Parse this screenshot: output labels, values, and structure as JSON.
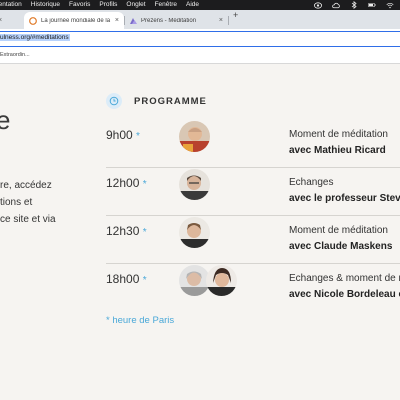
{
  "menubar": {
    "items": [
      "présentation",
      "Historique",
      "Favoris",
      "Profils",
      "Onglet",
      "Fenêtre",
      "Aide"
    ]
  },
  "tabs": [
    {
      "label": "La journée mondiale de la Méditation",
      "close": "×"
    },
    {
      "label": "Prezens - Méditation",
      "close": "×"
    }
  ],
  "new_tab": "+",
  "address_bar": {
    "url": "ulness.org/#meditations"
  },
  "bookmarks": {
    "item": "Extraordin..."
  },
  "left_text": {
    "heading": "e",
    "lines": [
      "re, accédez",
      "tions et",
      "ce site et via"
    ]
  },
  "programme": {
    "title": "PROGRAMME",
    "rows": [
      {
        "time": "9h00",
        "star": "*",
        "line1": "Moment de méditation",
        "line2": "avec Mathieu Ricard"
      },
      {
        "time": "12h00",
        "star": "*",
        "line1": "Echanges",
        "line2": "avec le professeur Steven"
      },
      {
        "time": "12h30",
        "star": "*",
        "line1": "Moment de méditation",
        "line2": "avec Claude Maskens"
      },
      {
        "time": "18h00",
        "star": "*",
        "line1": "Echanges & moment de m",
        "line2": "avec Nicole Bordeleau et"
      }
    ],
    "footnote": "* heure de Paris"
  },
  "colors": {
    "accent": "#4aa8d8",
    "omnibox_border": "#2f6ee8",
    "page_bg": "#f6f4f1"
  }
}
